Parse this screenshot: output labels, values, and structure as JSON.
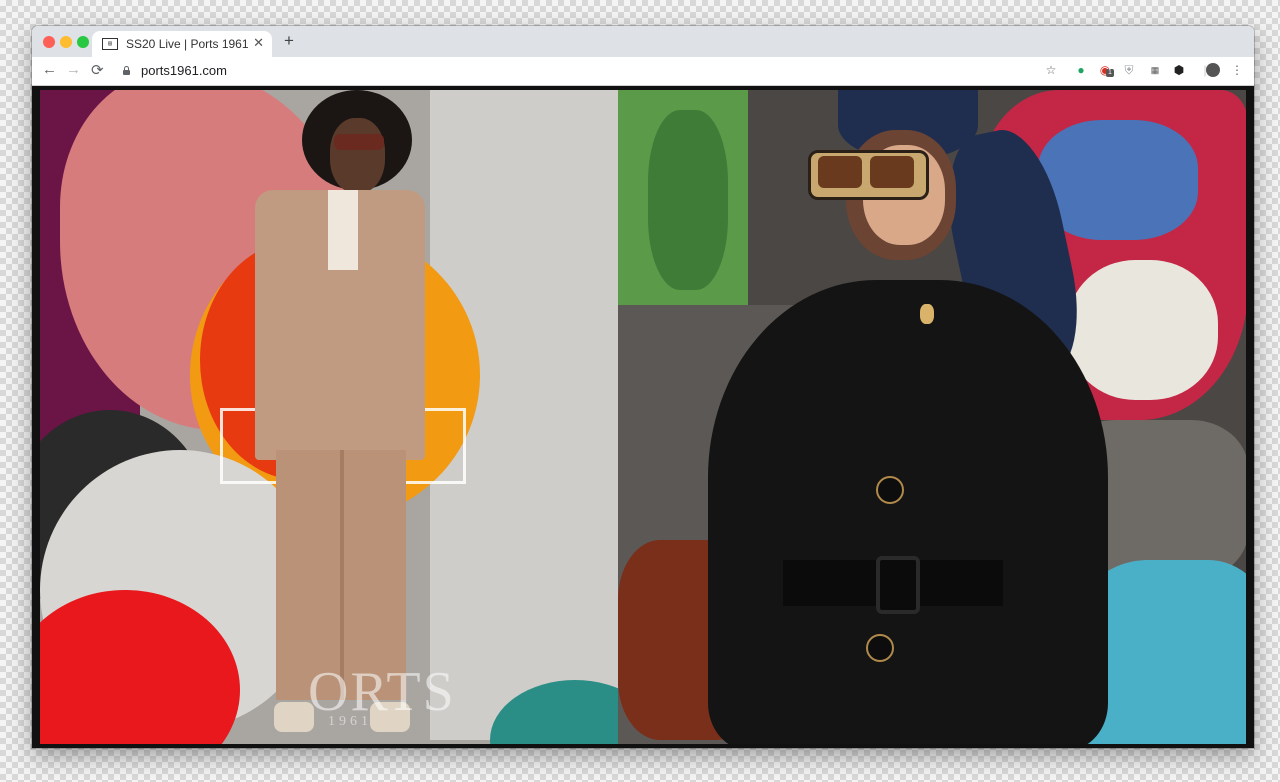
{
  "browser": {
    "tab_title": "SS20 Live | Ports 1961",
    "tab_favicon": "news-icon",
    "new_tab_symbol": "+",
    "url": "ports1961.com",
    "extension_badge": "1"
  },
  "page": {
    "left_image_text": "ORTS",
    "left_image_subtext": "1961"
  },
  "colors": {
    "tabbar": "#dee1e6",
    "red_accent": "#e8181c",
    "orange_accent": "#f19a12",
    "teal_accent": "#4ab0c8"
  }
}
